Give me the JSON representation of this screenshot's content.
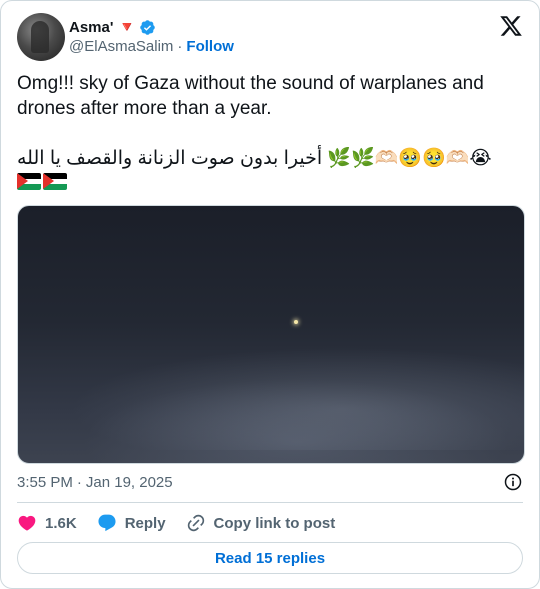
{
  "author": {
    "name": "Asma' 🔻",
    "handle": "@ElAsmaSalim",
    "follow_label": "Follow",
    "separator": "·"
  },
  "tweet": {
    "text_en": "Omg!!! sky of Gaza without the sound of warplanes and drones after more than a year.",
    "text_ar": "😭🫶🏻🥹🥹🫶🏻🌿🌿 أخيرا بدون صوت الزنانة والقصف يا الله",
    "flags": [
      "palestine-flag",
      "palestine-flag"
    ]
  },
  "meta": {
    "time": "3:55 PM",
    "separator": "·",
    "date": "Jan 19, 2025"
  },
  "actions": {
    "like_count": "1.6K",
    "reply_label": "Reply",
    "copy_label": "Copy link to post"
  },
  "footer": {
    "replies_label": "Read 15 replies"
  },
  "colors": {
    "accent": "#006fd6",
    "verified": "#1d9bf0",
    "like": "#f91880",
    "text": "#0f1419",
    "muted": "#536471",
    "border": "#cfd9de"
  },
  "icons": [
    "verified-badge-icon",
    "x-logo-icon",
    "info-icon",
    "heart-icon",
    "reply-bubble-icon",
    "link-icon"
  ]
}
